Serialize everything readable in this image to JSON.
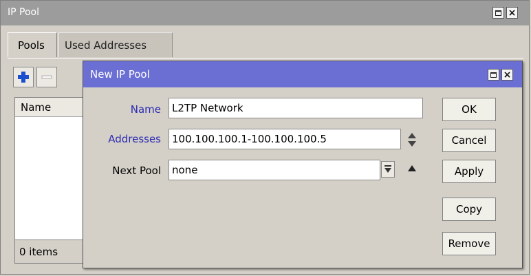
{
  "window": {
    "title": "IP Pool"
  },
  "tabs": [
    {
      "label": "Pools",
      "active": true
    },
    {
      "label": "Used Addresses",
      "active": false
    }
  ],
  "toolbar": {
    "add_icon": "plus-icon",
    "remove_icon": "minus-icon"
  },
  "list": {
    "column_header": "Name",
    "status": "0 items"
  },
  "dialog": {
    "title": "New IP Pool",
    "fields": {
      "name": {
        "label": "Name",
        "value": "L2TP Network"
      },
      "addresses": {
        "label": "Addresses",
        "value": "100.100.100.1-100.100.100.5"
      },
      "next_pool": {
        "label": "Next Pool",
        "value": "none"
      }
    },
    "buttons": {
      "ok": "OK",
      "cancel": "Cancel",
      "apply": "Apply",
      "copy": "Copy",
      "remove": "Remove"
    }
  },
  "colors": {
    "dialog_title": "#6b6fd3",
    "window_title": "#9c9c9c",
    "label_highlight": "#2b2bb0",
    "add_icon": "#1a4fd0"
  }
}
